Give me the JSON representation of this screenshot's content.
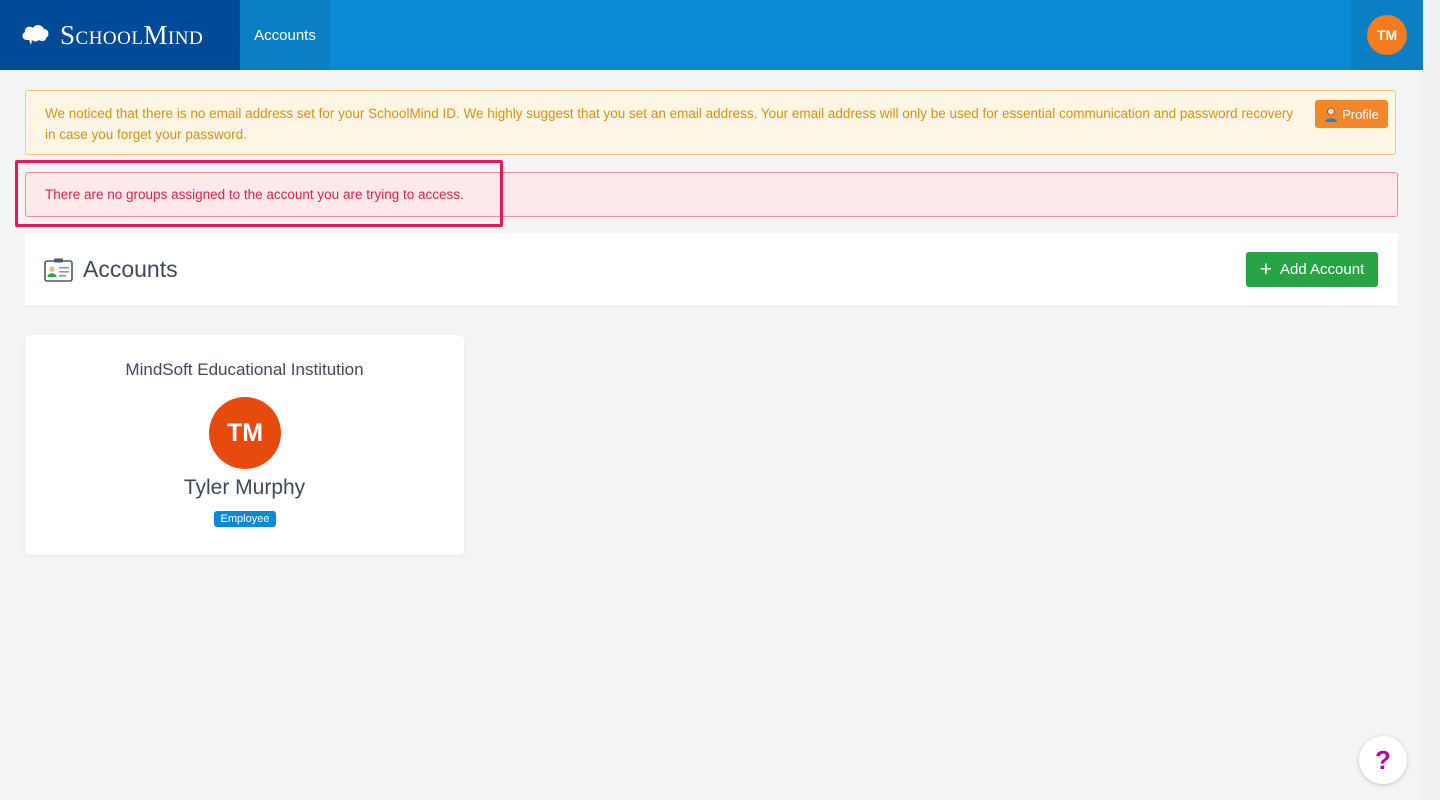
{
  "header": {
    "brand": "SchoolMind",
    "nav_accounts": "Accounts",
    "user_initials": "TM"
  },
  "alerts": {
    "warning": "We noticed that there is no email address set for your SchoolMind ID. We highly suggest that you set an email address. Your email address will only be used for essential communication and password recovery in case you forget your password.",
    "profile_button": "Profile",
    "danger": "There are no groups assigned to the account you are trying to access."
  },
  "accounts_panel": {
    "title": "Accounts",
    "add_button": "Add Account"
  },
  "account_card": {
    "organization": "MindSoft Educational Institution",
    "initials": "TM",
    "name": "Tyler Murphy",
    "role": "Employee"
  },
  "help": {
    "label": "?"
  },
  "colors": {
    "topbar": "#0a8ad4",
    "brand_bg": "#004a97",
    "avatar": "#e64a0d",
    "add_button": "#27a545",
    "profile_button": "#f4862a",
    "highlight": "#e8175d"
  },
  "icons": {
    "brand": "cloud-icon",
    "profile": "user-icon",
    "accounts": "id-card-icon",
    "add": "plus-icon",
    "help": "question-icon"
  }
}
